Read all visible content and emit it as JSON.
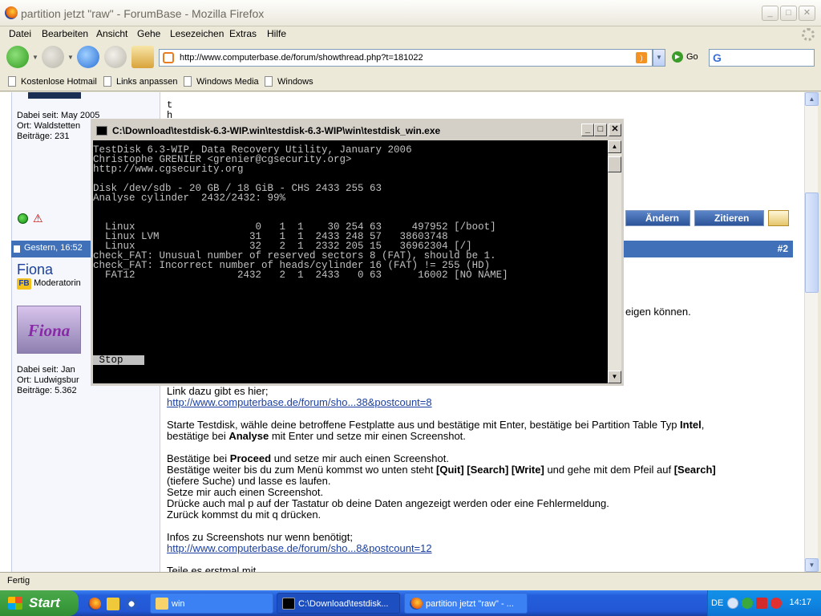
{
  "window": {
    "title": "partition jetzt \"raw\" - ForumBase - Mozilla Firefox",
    "minimize": "_",
    "maximize": "□",
    "close": "✕"
  },
  "menu": [
    "Datei",
    "Bearbeiten",
    "Ansicht",
    "Gehe",
    "Lesezeichen",
    "Extras",
    "Hilfe"
  ],
  "nav": {
    "url": "http://www.computerbase.de/forum/showthread.php?t=181022",
    "go_label": "Go"
  },
  "bookmarks": [
    "Kostenlose Hotmail",
    "Links anpassen",
    "Windows Media",
    "Windows"
  ],
  "forum": {
    "prev_user": {
      "joined": "Dabei seit: May 2005",
      "location": "Ort: Waldstetten",
      "posts": "Beiträge: 231"
    },
    "actions": {
      "edit": "Ändern",
      "quote": "Zitieren"
    },
    "post": {
      "date": "Gestern, 16:52",
      "number": "#2",
      "author": "Fiona",
      "role": "Moderatorin",
      "avatar_text": "Fiona",
      "joined": "Dabei seit: Jan",
      "location": "Ort: Ludwigsbur",
      "posts": "Beiträge: 5.362"
    },
    "prev_post_fragment": [
      "t",
      "h"
    ],
    "partial_text": "eigen können.",
    "body": {
      "link_intro": "Link dazu gibt es hier;",
      "link1": "http://www.computerbase.de/forum/sho...38&postcount=8",
      "p1_a": "Starte Testdisk, wähle deine betroffene Festplatte aus und bestätige mit Enter, bestätige bei Partition Table Typ ",
      "p1_b": "Intel",
      "p1_c": ",",
      "p1_d": "bestätige bei ",
      "p1_e": "Analyse",
      "p1_f": " mit Enter und setze mir einen Screenshot.",
      "p2_a": "Bestätige bei ",
      "p2_b": "Proceed",
      "p2_c": " und setze mir auch einen Screenshot.",
      "p3_a": "Bestätige weiter bis du zum Menü kommst wo unten steht ",
      "p3_b": "[Quit] [Search] [Write]",
      "p3_c": " und gehe mit dem Pfeil auf ",
      "p3_d": "[Search]",
      "p3_e": "(tiefere Suche) und lasse es laufen.",
      "p3_f": "Setze mir auch einen Screenshot.",
      "p3_g": "Drücke auch mal p auf der Tastatur ob deine Daten angezeigt werden oder eine Fehlermeldung.",
      "p3_h": "Zurück kommst du mit q drücken.",
      "p4_a": "Infos zu Screenshots nur wenn benötigt;",
      "link2": "http://www.computerbase.de/forum/sho...8&postcount=12",
      "p5": "Teile es erstmal mit"
    }
  },
  "console": {
    "title": "C:\\Download\\testdisk-6.3-WIP.win\\testdisk-6.3-WIP\\win\\testdisk_win.exe",
    "lines": [
      "TestDisk 6.3-WIP, Data Recovery Utility, January 2006",
      "Christophe GRENIER <grenier@cgsecurity.org>",
      "http://www.cgsecurity.org",
      "",
      "Disk /dev/sdb - 20 GB / 18 GiB - CHS 2433 255 63",
      "Analyse cylinder  2432/2432: 99%",
      "",
      "",
      "  Linux                    0   1  1    30 254 63     497952 [/boot]",
      "  Linux LVM               31   1  1  2433 248 57   38603748",
      "  Linux                   32   2  1  2332 205 15   36962304 [/]",
      "check_FAT: Unusual number of reserved sectors 8 (FAT), should be 1.",
      "check_FAT: Incorrect number of heads/cylinder 16 (FAT) != 255 (HD)",
      "  FAT12                 2432   2  1  2433   0 63      16002 [NO NAME]"
    ],
    "stop_label": " Stop"
  },
  "status": "Fertig",
  "taskbar": {
    "start": "Start",
    "items": [
      "win",
      "C:\\Download\\testdisk...",
      "partition jetzt \"raw\" - ..."
    ],
    "lang": "DE",
    "time": "14:17"
  }
}
